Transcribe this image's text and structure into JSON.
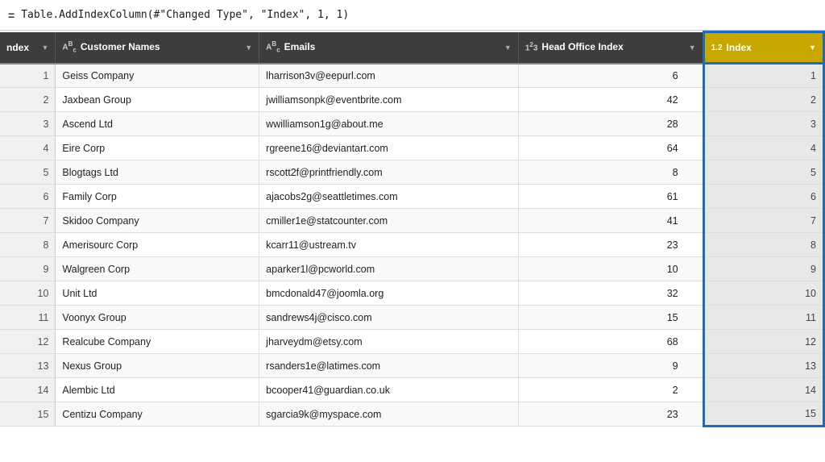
{
  "formula": {
    "icon": "=",
    "text": "Table.AddIndexColumn(#\"Changed Type\", \"Index\", 1, 1)"
  },
  "columns": {
    "index": {
      "label": "Index",
      "type": ""
    },
    "customer_names": {
      "label": "Customer Names",
      "type": "ABc"
    },
    "emails": {
      "label": "Emails",
      "type": "ABc"
    },
    "head_office_index": {
      "label": "Head Office Index",
      "type": "1²3"
    },
    "index_val": {
      "label": "Index",
      "type": "1.2"
    }
  },
  "rows": [
    {
      "num": 1,
      "customer": "Geiss Company",
      "email": "lharrison3v@eepurl.com",
      "head_office": 6,
      "index": 1
    },
    {
      "num": 2,
      "customer": "Jaxbean Group",
      "email": "jwilliamsonpk@eventbrite.com",
      "head_office": 42,
      "index": 2
    },
    {
      "num": 3,
      "customer": "Ascend Ltd",
      "email": "wwilliamson1g@about.me",
      "head_office": 28,
      "index": 3
    },
    {
      "num": 4,
      "customer": "Eire Corp",
      "email": "rgreene16@deviantart.com",
      "head_office": 64,
      "index": 4
    },
    {
      "num": 5,
      "customer": "Blogtags Ltd",
      "email": "rscott2f@printfriendly.com",
      "head_office": 8,
      "index": 5
    },
    {
      "num": 6,
      "customer": "Family Corp",
      "email": "ajacobs2g@seattletimes.com",
      "head_office": 61,
      "index": 6
    },
    {
      "num": 7,
      "customer": "Skidoo Company",
      "email": "cmiller1e@statcounter.com",
      "head_office": 41,
      "index": 7
    },
    {
      "num": 8,
      "customer": "Amerisourc Corp",
      "email": "kcarr11@ustream.tv",
      "head_office": 23,
      "index": 8
    },
    {
      "num": 9,
      "customer": "Walgreen Corp",
      "email": "aparker1l@pcworld.com",
      "head_office": 10,
      "index": 9
    },
    {
      "num": 10,
      "customer": "Unit Ltd",
      "email": "bmcdonald47@joomla.org",
      "head_office": 32,
      "index": 10
    },
    {
      "num": 11,
      "customer": "Voonyx Group",
      "email": "sandrews4j@cisco.com",
      "head_office": 15,
      "index": 11
    },
    {
      "num": 12,
      "customer": "Realcube Company",
      "email": "jharveydm@etsy.com",
      "head_office": 68,
      "index": 12
    },
    {
      "num": 13,
      "customer": "Nexus Group",
      "email": "rsanders1e@latimes.com",
      "head_office": 9,
      "index": 13
    },
    {
      "num": 14,
      "customer": "Alembic Ltd",
      "email": "bcooper41@guardian.co.uk",
      "head_office": 2,
      "index": 14
    },
    {
      "num": 15,
      "customer": "Centizu Company",
      "email": "sgarcia9k@myspace.com",
      "head_office": 23,
      "index": 15
    }
  ]
}
